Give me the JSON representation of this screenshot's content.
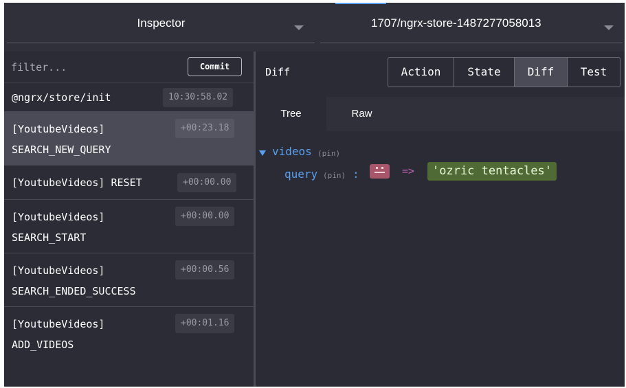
{
  "topbar": {
    "monitor_select": "Inspector",
    "instance_select": "1707/ngrx-store-1487277058013"
  },
  "actions_panel": {
    "filter_placeholder": "filter...",
    "commit_label": "Commit",
    "items": [
      {
        "line1": "@ngrx/store/init",
        "line2": "",
        "time": "10:30:58.02",
        "selected": false
      },
      {
        "line1": "[YoutubeVideos]",
        "line2": "SEARCH_NEW_QUERY",
        "time": "+00:23.18",
        "selected": true
      },
      {
        "line1": "[YoutubeVideos] RESET",
        "line2": "",
        "time": "+00:00.00",
        "selected": false
      },
      {
        "line1": "[YoutubeVideos]",
        "line2": "SEARCH_START",
        "time": "+00:00.00",
        "selected": false
      },
      {
        "line1": "[YoutubeVideos]",
        "line2": "SEARCH_ENDED_SUCCESS",
        "time": "+00:00.56",
        "selected": false
      },
      {
        "line1": "[YoutubeVideos]",
        "line2": "ADD_VIDEOS",
        "time": "+00:01.16",
        "selected": false
      }
    ]
  },
  "detail_panel": {
    "title": "Diff",
    "tabs": [
      {
        "label": "Action",
        "active": false
      },
      {
        "label": "State",
        "active": false
      },
      {
        "label": "Diff",
        "active": true
      },
      {
        "label": "Test",
        "active": false
      }
    ],
    "subtabs": [
      {
        "label": "Tree",
        "active": true
      },
      {
        "label": "Raw",
        "active": false
      }
    ],
    "tree": {
      "root_key": "videos",
      "root_pin": "(pin)",
      "child_key": "query",
      "child_pin": "(pin)",
      "colon": ":",
      "arrow": "=>",
      "old_value_icon": "empty-value-icon",
      "new_value": "'ozric tentacles'"
    }
  },
  "colors": {
    "background": "#2a2b35",
    "accent_key": "#5aa0f0",
    "removed": "#a8566a",
    "added": "#4f6a34",
    "arrow": "#c264b8"
  }
}
